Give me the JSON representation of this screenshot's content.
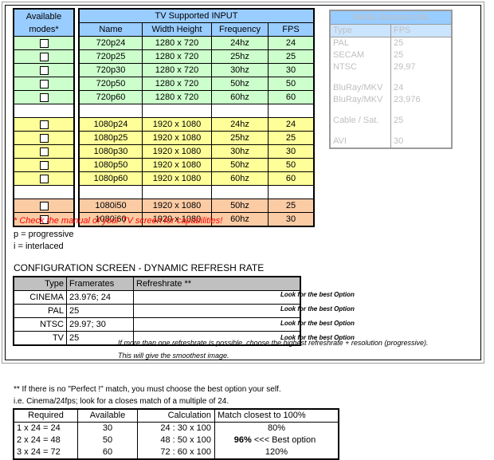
{
  "tv_table": {
    "available_header": "Available\nmodes*",
    "available_header_line1": "Available",
    "available_header_line2": "modes*",
    "title": "TV Supported INPUT",
    "columns": [
      "Name",
      "Width      Height",
      "Frequency",
      "FPS"
    ],
    "col_name": "Name",
    "col_res": "Width      Height",
    "col_freq": "Frequency",
    "col_fps": "FPS",
    "groups": [
      {
        "color": "#ccffcc",
        "rows": [
          {
            "checkbox": true,
            "name": "720p24",
            "resolution": "1280 x 720",
            "frequency": "24hz",
            "fps": "24"
          },
          {
            "checkbox": true,
            "name": "720p25",
            "resolution": "1280 x 720",
            "frequency": "25hz",
            "fps": "25"
          },
          {
            "checkbox": true,
            "name": "720p30",
            "resolution": "1280 x 720",
            "frequency": "30hz",
            "fps": "30"
          },
          {
            "checkbox": true,
            "name": "720p50",
            "resolution": "1280 x 720",
            "frequency": "50hz",
            "fps": "50"
          },
          {
            "checkbox": true,
            "name": "720p60",
            "resolution": "1280 x 720",
            "frequency": "60hz",
            "fps": "60"
          }
        ]
      },
      {
        "color": "#ffff99",
        "rows": [
          {
            "checkbox": true,
            "name": "1080p24",
            "resolution": "1920 x 1080",
            "frequency": "24hz",
            "fps": "24"
          },
          {
            "checkbox": true,
            "name": "1080p25",
            "resolution": "1920 x 1080",
            "frequency": "25hz",
            "fps": "25"
          },
          {
            "checkbox": true,
            "name": "1080p30",
            "resolution": "1920 x 1080",
            "frequency": "30hz",
            "fps": "30"
          },
          {
            "checkbox": true,
            "name": "1080p50",
            "resolution": "1920 x 1080",
            "frequency": "50hz",
            "fps": "50"
          },
          {
            "checkbox": true,
            "name": "1080p60",
            "resolution": "1920 x 1080",
            "frequency": "60hz",
            "fps": "60"
          }
        ]
      },
      {
        "color": "#fbcba4",
        "rows": [
          {
            "checkbox": true,
            "name": "1080i50",
            "resolution": "1920 x 1080",
            "frequency": "50hz",
            "fps": "25"
          },
          {
            "checkbox": true,
            "name": "1080i60",
            "resolution": "1920 x 1080",
            "frequency": "60hz",
            "fps": "30"
          }
        ]
      }
    ]
  },
  "media_sources": {
    "title": "Media Sources Info",
    "col_type": "Type",
    "col_fps": "FPS",
    "rows": [
      {
        "type": "PAL",
        "fps": "25"
      },
      {
        "type": "SECAM",
        "fps": "25"
      },
      {
        "type": "NTSC",
        "fps": "29,97"
      },
      {
        "type": "BluRay/MKV",
        "fps": "24"
      },
      {
        "type": "BluRay/MKV",
        "fps": "23,976"
      },
      {
        "type": "Cable / Sat.",
        "fps": "25"
      },
      {
        "type": "AVI",
        "fps": "30"
      }
    ]
  },
  "notes": {
    "star": "* Check the manual of your TV screen for capabilities!",
    "progressive": "p = progressive",
    "interlaced": "i = interlaced",
    "star_color": "#ff0000"
  },
  "config": {
    "title": "CONFIGURATION SCREEN - DYNAMIC REFRESH RATE",
    "col_type": "Type",
    "col_framerates": "Framerates",
    "col_refreshrate": "Refreshrate **",
    "rows": [
      {
        "type": "CINEMA",
        "framerates": "23.976; 24",
        "refreshrate": "",
        "hint": "Look for the best Option"
      },
      {
        "type": "PAL",
        "framerates": "25",
        "refreshrate": "",
        "hint": "Look for the best Option"
      },
      {
        "type": "NTSC",
        "framerates": "29.97; 30",
        "refreshrate": "",
        "hint": "Look for the best Option"
      },
      {
        "type": "TV",
        "framerates": "25",
        "refreshrate": "",
        "hint": "Look for the best Option"
      }
    ],
    "subnote_1": "If more than one refreshrate is possible, choose the highest refreshrate + resolution (progressive).",
    "subnote_2": "This will give the smoothest image."
  },
  "footer": {
    "line_1": "** If there is no \"Perfect !\" match, you must choose the best option your self.",
    "line_2": "i.e. Cinema/24fps; look for a closes match of a multiple of 24.",
    "calc_table": {
      "columns": [
        "Required",
        "Available",
        "Calculation",
        "Match closest to 100%"
      ],
      "col_required": "Required",
      "col_available": "Available",
      "col_calculation": "Calculation",
      "col_match": "Match closest to 100%",
      "rows": [
        {
          "required": "1 x 24 = 24",
          "available": "30",
          "calculation": "24 : 30 x  100",
          "match": "80%",
          "best": ""
        },
        {
          "required": "2 x 24 = 48",
          "available": "50",
          "calculation": "48 : 50 x  100",
          "match": "96%",
          "best": "<<< Best option"
        },
        {
          "required": "3 x 24 = 72",
          "available": "60",
          "calculation": "72 : 60 x  100",
          "match": "120%",
          "best": ""
        }
      ]
    }
  }
}
